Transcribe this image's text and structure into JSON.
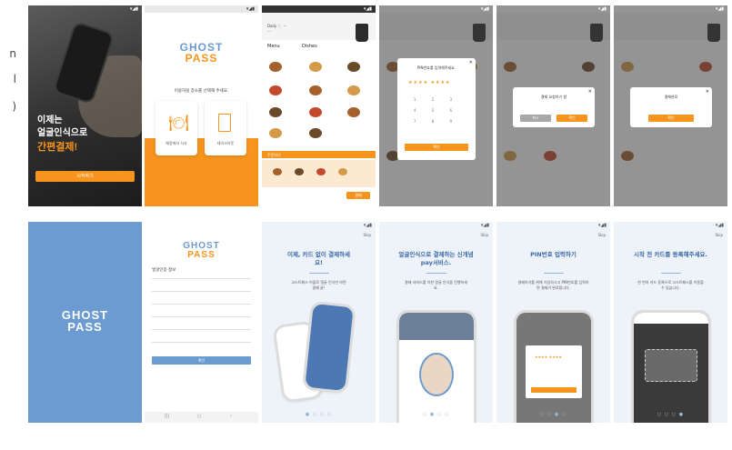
{
  "edge_glyphs": [
    "n",
    "l",
    ")"
  ],
  "status_time": "▾◢▮",
  "screens": {
    "intro": {
      "line1": "이제는",
      "line2": "얼굴인식으로",
      "line3": "간편결제!",
      "cta": "시작하기"
    },
    "brand": {
      "logo_top": "GHOST",
      "logo_bottom": "PASS"
    },
    "place_select": {
      "prompt": "이용하실 장소를 선택해 주세요.",
      "option_dine_in": "매장에서 식사",
      "option_takeout": "테이크아웃"
    },
    "menu": {
      "tab_menu": "Menu",
      "tab_dishes": "Dishes",
      "order_label": "주문하기",
      "pay_button": "결제"
    },
    "pin_modal": {
      "title": "PIN번호를 입력해주세요.",
      "confirm": "확인"
    },
    "payment_confirm": {
      "title": "결제 요청하기 창",
      "cancel": "취소",
      "confirm": "확인"
    },
    "payment_done": {
      "title": "결제완료",
      "confirm": "확인"
    },
    "register": {
      "title": "얼굴인증 정보",
      "confirm": "확인"
    },
    "onboard_card": {
      "skip": "Skip",
      "title": "이제, 카드 없이 결제하세요!",
      "desc": "고스트패스 어플로 얼굴 인식만 하면 결제 끝!"
    },
    "onboard_face": {
      "skip": "Skip",
      "title": "얼굴인식으로 결제하는 신개념 pay서비스.",
      "desc": "결제 서비스를 이한 얼굴 인식을 진행하세요."
    },
    "onboard_pin": {
      "skip": "Skip",
      "title": "PIN번호 입력하기",
      "desc": "결제하기를 위해 가입하시고 PIN번호를 입력하면 결제가 완료됩니다."
    },
    "onboard_card_reg": {
      "skip": "Skip",
      "title": "시작 전 카드를 등록해주세요.",
      "desc": "한 번의 카드 등록으로 고스트패스를 이용할 수 있습니다."
    }
  },
  "colors": {
    "accent": "#f7941d",
    "blue": "#6b9bd1",
    "heading_blue": "#3d6aa8"
  }
}
